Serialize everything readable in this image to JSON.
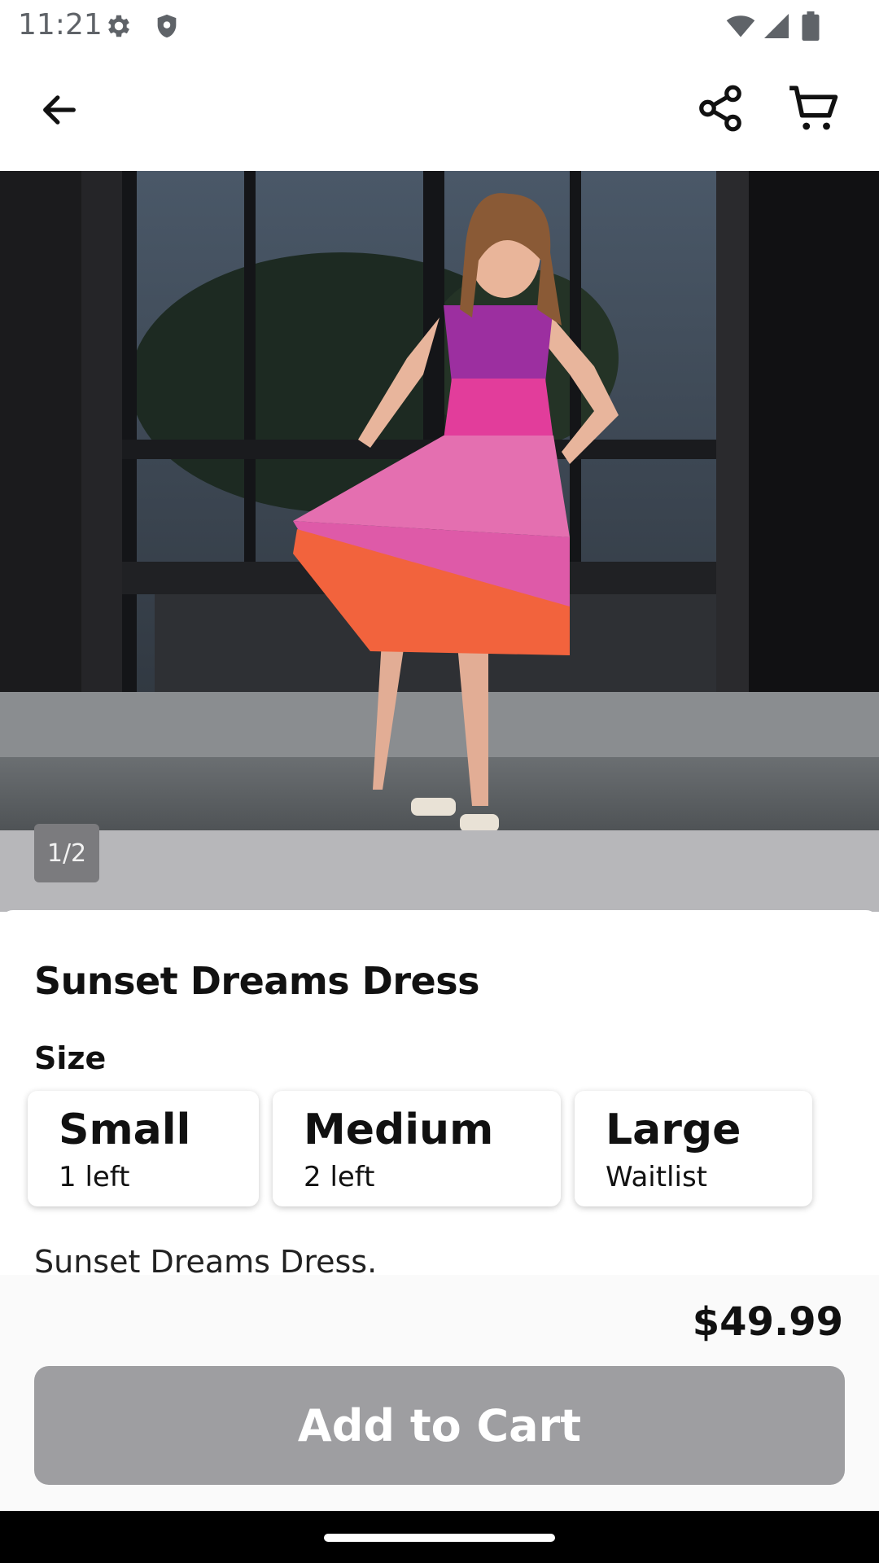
{
  "status_bar": {
    "time": "11:21",
    "icons": [
      "gear-icon",
      "shield-icon",
      "wifi-icon",
      "signal-icon",
      "battery-icon"
    ]
  },
  "app_bar": {
    "icons": [
      "back-arrow-icon",
      "share-icon",
      "cart-icon"
    ]
  },
  "gallery": {
    "page_indicator": "1/2",
    "image_description_colors": {
      "dress_top": "#9c2fa0",
      "dress_middle": "#e23d9b",
      "dress_hem": "#f2633d"
    }
  },
  "product": {
    "title": "Sunset Dreams Dress",
    "size_label": "Size",
    "sizes": [
      {
        "name": "Small",
        "stock": "1 left"
      },
      {
        "name": "Medium",
        "stock": "2 left"
      },
      {
        "name": "Large",
        "stock": "Waitlist"
      }
    ],
    "description": "Sunset Dreams Dress."
  },
  "purchase": {
    "price": "$49.99",
    "add_to_cart_label": "Add to Cart"
  },
  "colors": {
    "button_disabled": "#9e9ea1",
    "overlay_gray": "#b7b7ba"
  }
}
